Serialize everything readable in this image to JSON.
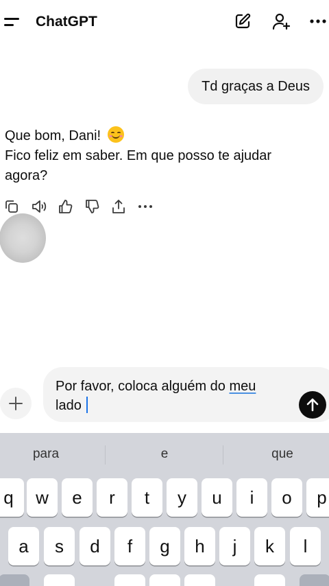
{
  "header": {
    "title": "ChatGPT",
    "menu_icon": "hamburger-icon",
    "new_chat_icon": "edit-icon",
    "add_person_icon": "add-person-icon",
    "more_icon": "more-icon"
  },
  "messages": {
    "user": "Td graças a Deus",
    "assistant_line1": "Que bom, Dani!",
    "assistant_emoji": "smiling-face-emoji",
    "assistant_line2": "Fico feliz em saber. Em que posso te ajudar agora?"
  },
  "message_actions": [
    "copy-icon",
    "speaker-icon",
    "thumbs-up-icon",
    "thumbs-down-icon",
    "share-icon",
    "more-icon"
  ],
  "composer": {
    "text_part1": "Por favor, coloca alguém do ",
    "text_underlined": "meu",
    "text_part2": " lado ",
    "plus_icon": "plus-icon",
    "send_icon": "send-arrow-icon"
  },
  "keyboard": {
    "suggestions": [
      "para",
      "e",
      "que"
    ],
    "row1": [
      "q",
      "w",
      "e",
      "r",
      "t",
      "y",
      "u",
      "i",
      "o",
      "p"
    ],
    "row2": [
      "a",
      "s",
      "d",
      "f",
      "g",
      "h",
      "j",
      "k",
      "l"
    ]
  },
  "colors": {
    "accent_caret": "#1a73e8",
    "send_button": "#0d0d0d",
    "bubble": "#f1f1f1",
    "keyboard_bg": "#d3d5db"
  }
}
